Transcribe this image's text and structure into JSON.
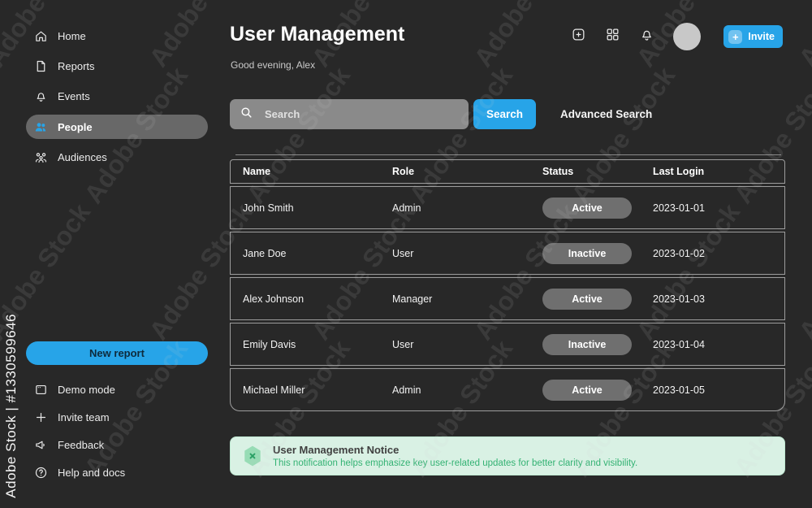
{
  "watermark": {
    "text": "Adobe Stock",
    "credit": "Adobe Stock | #1330599646"
  },
  "sidebar": {
    "items": [
      {
        "label": "Home",
        "icon": "home-icon"
      },
      {
        "label": "Reports",
        "icon": "document-icon"
      },
      {
        "label": "Events",
        "icon": "bell-icon"
      },
      {
        "label": "People",
        "icon": "people-icon",
        "active": true
      },
      {
        "label": "Audiences",
        "icon": "audience-icon"
      }
    ],
    "new_report_label": "New report",
    "footer_items": [
      {
        "label": "Demo mode",
        "icon": "window-icon"
      },
      {
        "label": "Invite team",
        "icon": "plus-icon"
      },
      {
        "label": "Feedback",
        "icon": "megaphone-icon"
      },
      {
        "label": "Help and docs",
        "icon": "help-icon"
      }
    ]
  },
  "header": {
    "title": "User Management",
    "greeting": "Good evening, Alex",
    "invite_label": "Invite",
    "invite_plus": "+"
  },
  "search": {
    "placeholder": "Search",
    "button_label": "Search",
    "advanced_label": "Advanced Search"
  },
  "table": {
    "headers": [
      "Name",
      "Role",
      "Status",
      "Last Login"
    ],
    "rows": [
      {
        "name": "John Smith",
        "role": "Admin",
        "status": "Active",
        "last_login": "2023-01-01"
      },
      {
        "name": "Jane Doe",
        "role": "User",
        "status": "Inactive",
        "last_login": "2023-01-02"
      },
      {
        "name": "Alex Johnson",
        "role": "Manager",
        "status": "Active",
        "last_login": "2023-01-03"
      },
      {
        "name": "Emily Davis",
        "role": "User",
        "status": "Inactive",
        "last_login": "2023-01-04"
      },
      {
        "name": "Michael Miller",
        "role": "Admin",
        "status": "Active",
        "last_login": "2023-01-05"
      }
    ]
  },
  "notice": {
    "title": "User Management Notice",
    "body": "This notification helps emphasize key user-related updates for better clarity and visibility."
  },
  "colors": {
    "accent_blue": "#27a4e8",
    "badge_gray": "#6f6f6f",
    "notice_bg": "#d9f1e4",
    "notice_green": "#33b273",
    "background": "#282828"
  }
}
